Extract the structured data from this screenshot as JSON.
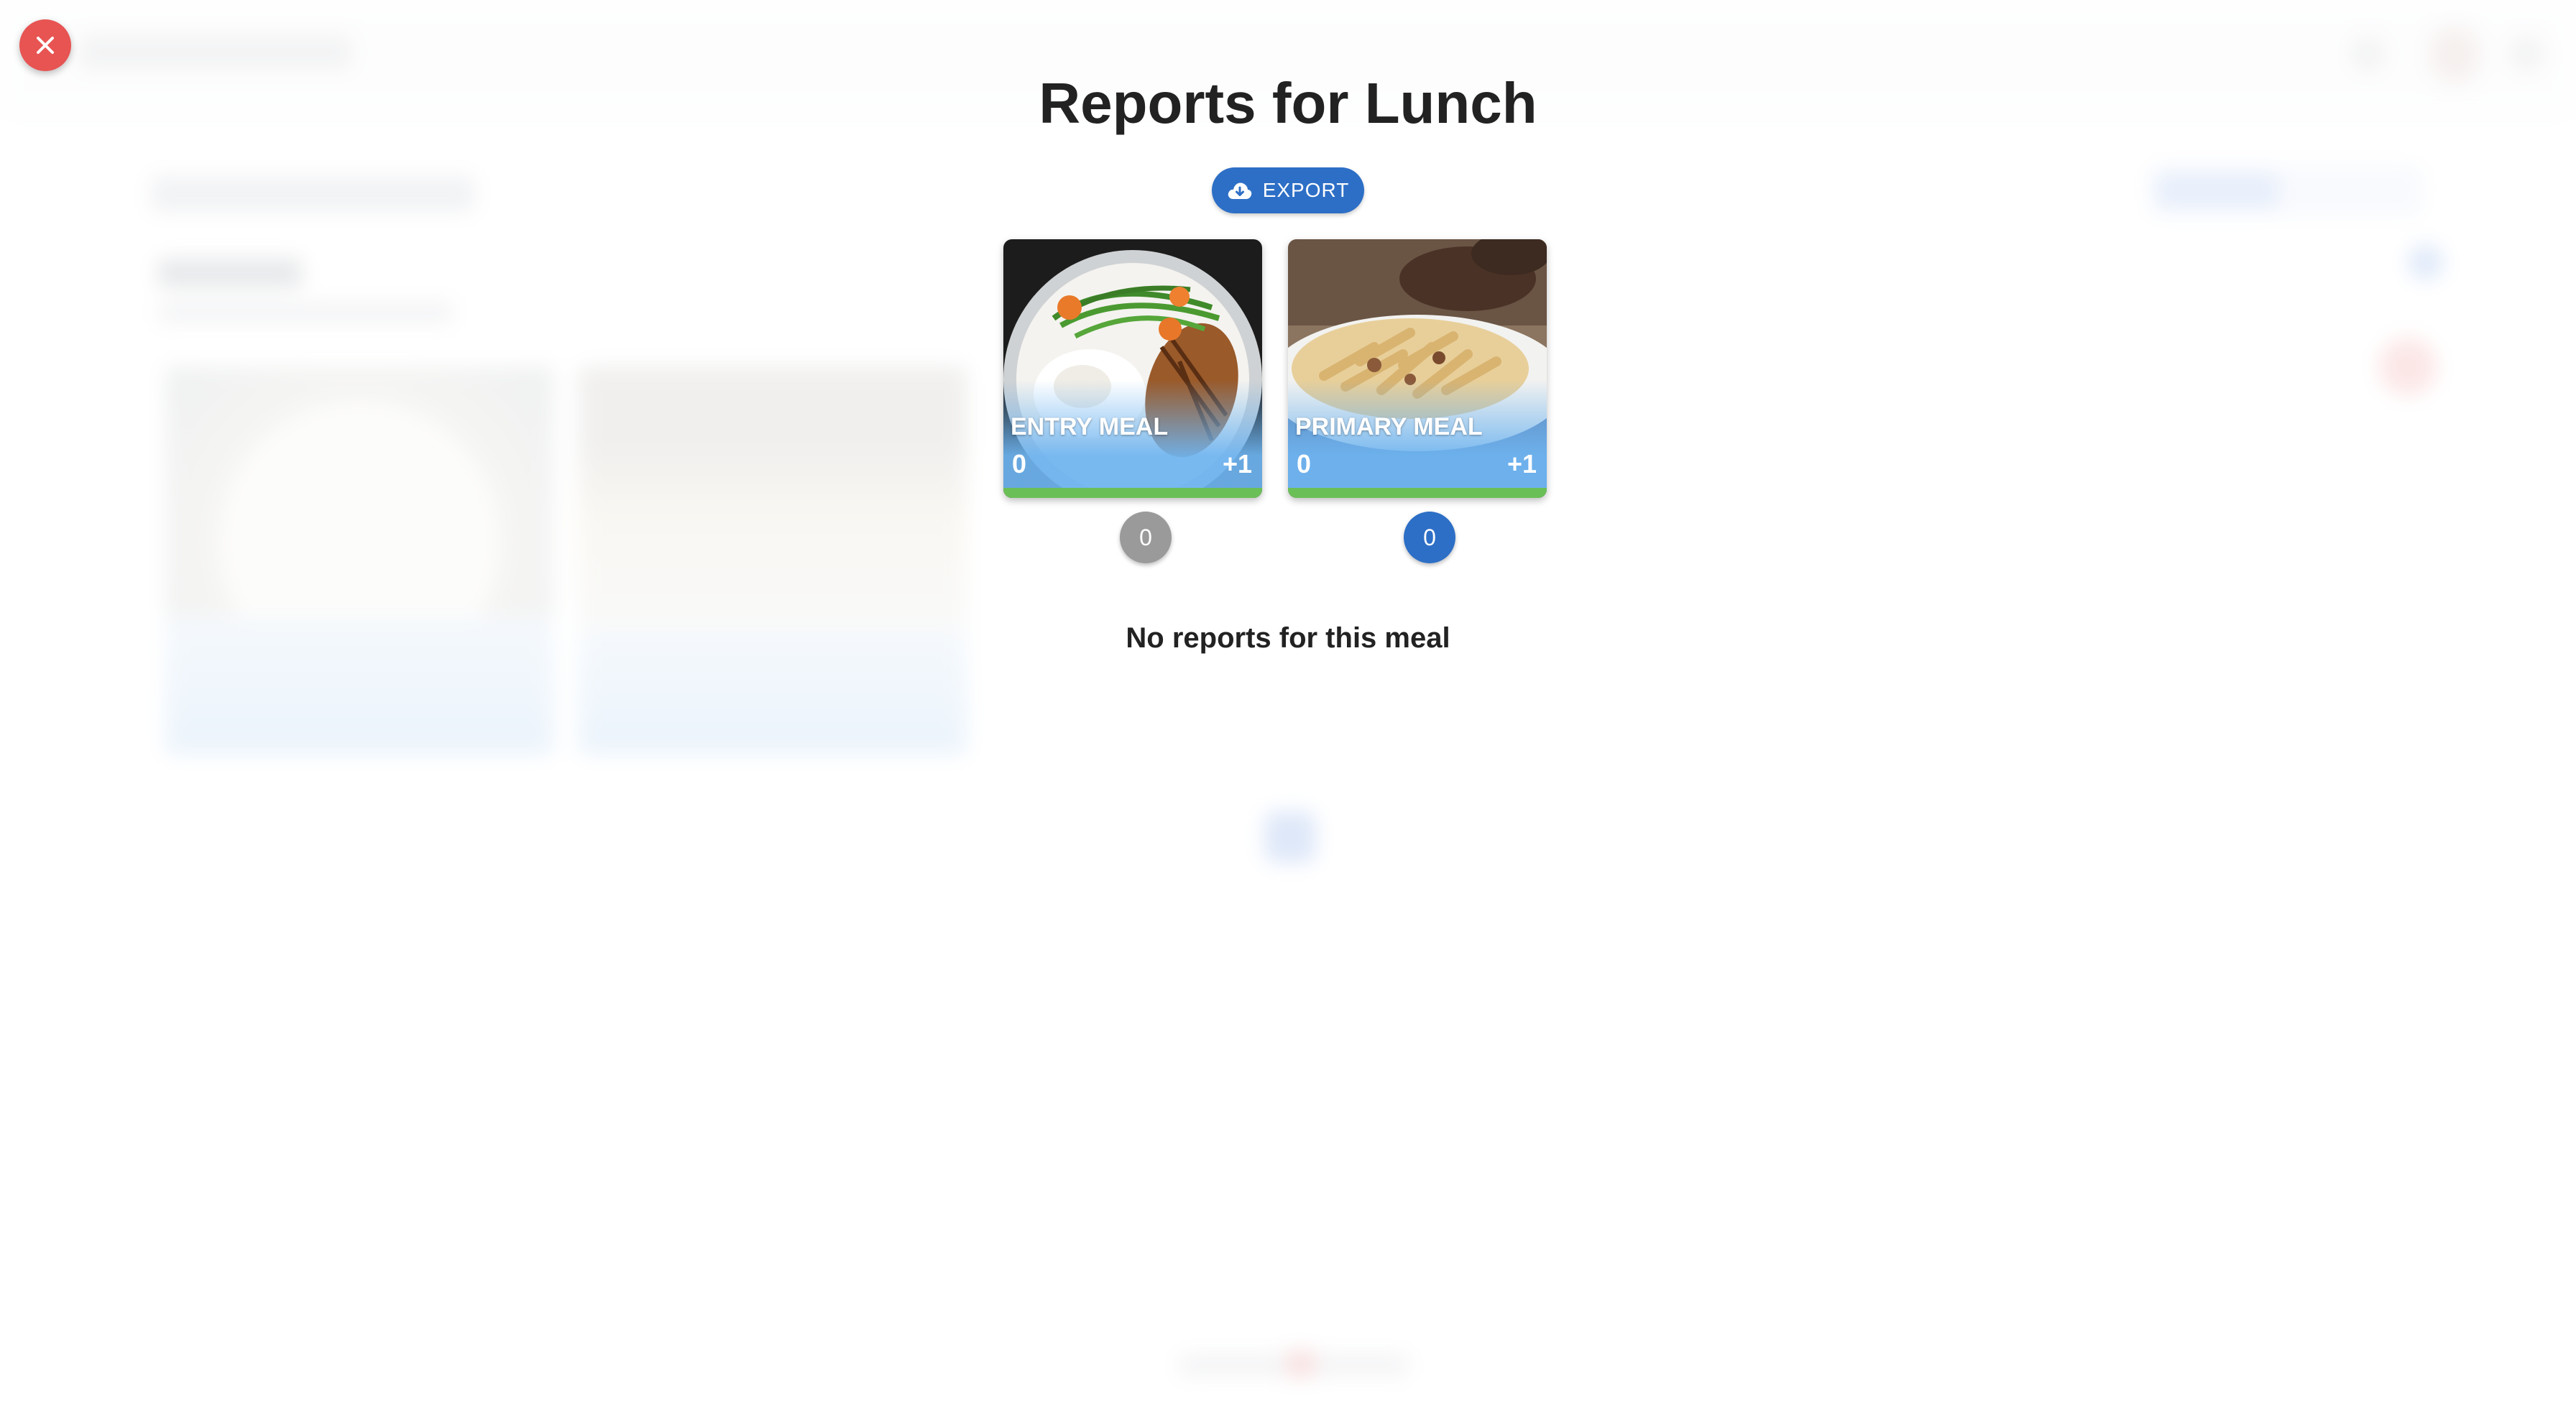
{
  "modal": {
    "title": "Reports for Lunch",
    "export_label": "EXPORT",
    "empty_message": "No reports for this meal"
  },
  "meals": [
    {
      "name": "ENTRY MEAL",
      "count": "0",
      "increment": "+1",
      "badge": "0",
      "badge_color": "#9a9a9a"
    },
    {
      "name": "PRIMARY MEAL",
      "count": "0",
      "increment": "+1",
      "badge": "0",
      "badge_color": "#2d6fc6"
    }
  ],
  "colors": {
    "accent": "#2d6fc6",
    "close": "#e75452",
    "meal_bar": "#6bbf57"
  },
  "icons": {
    "close": "close-icon",
    "export": "cloud-download-icon"
  }
}
